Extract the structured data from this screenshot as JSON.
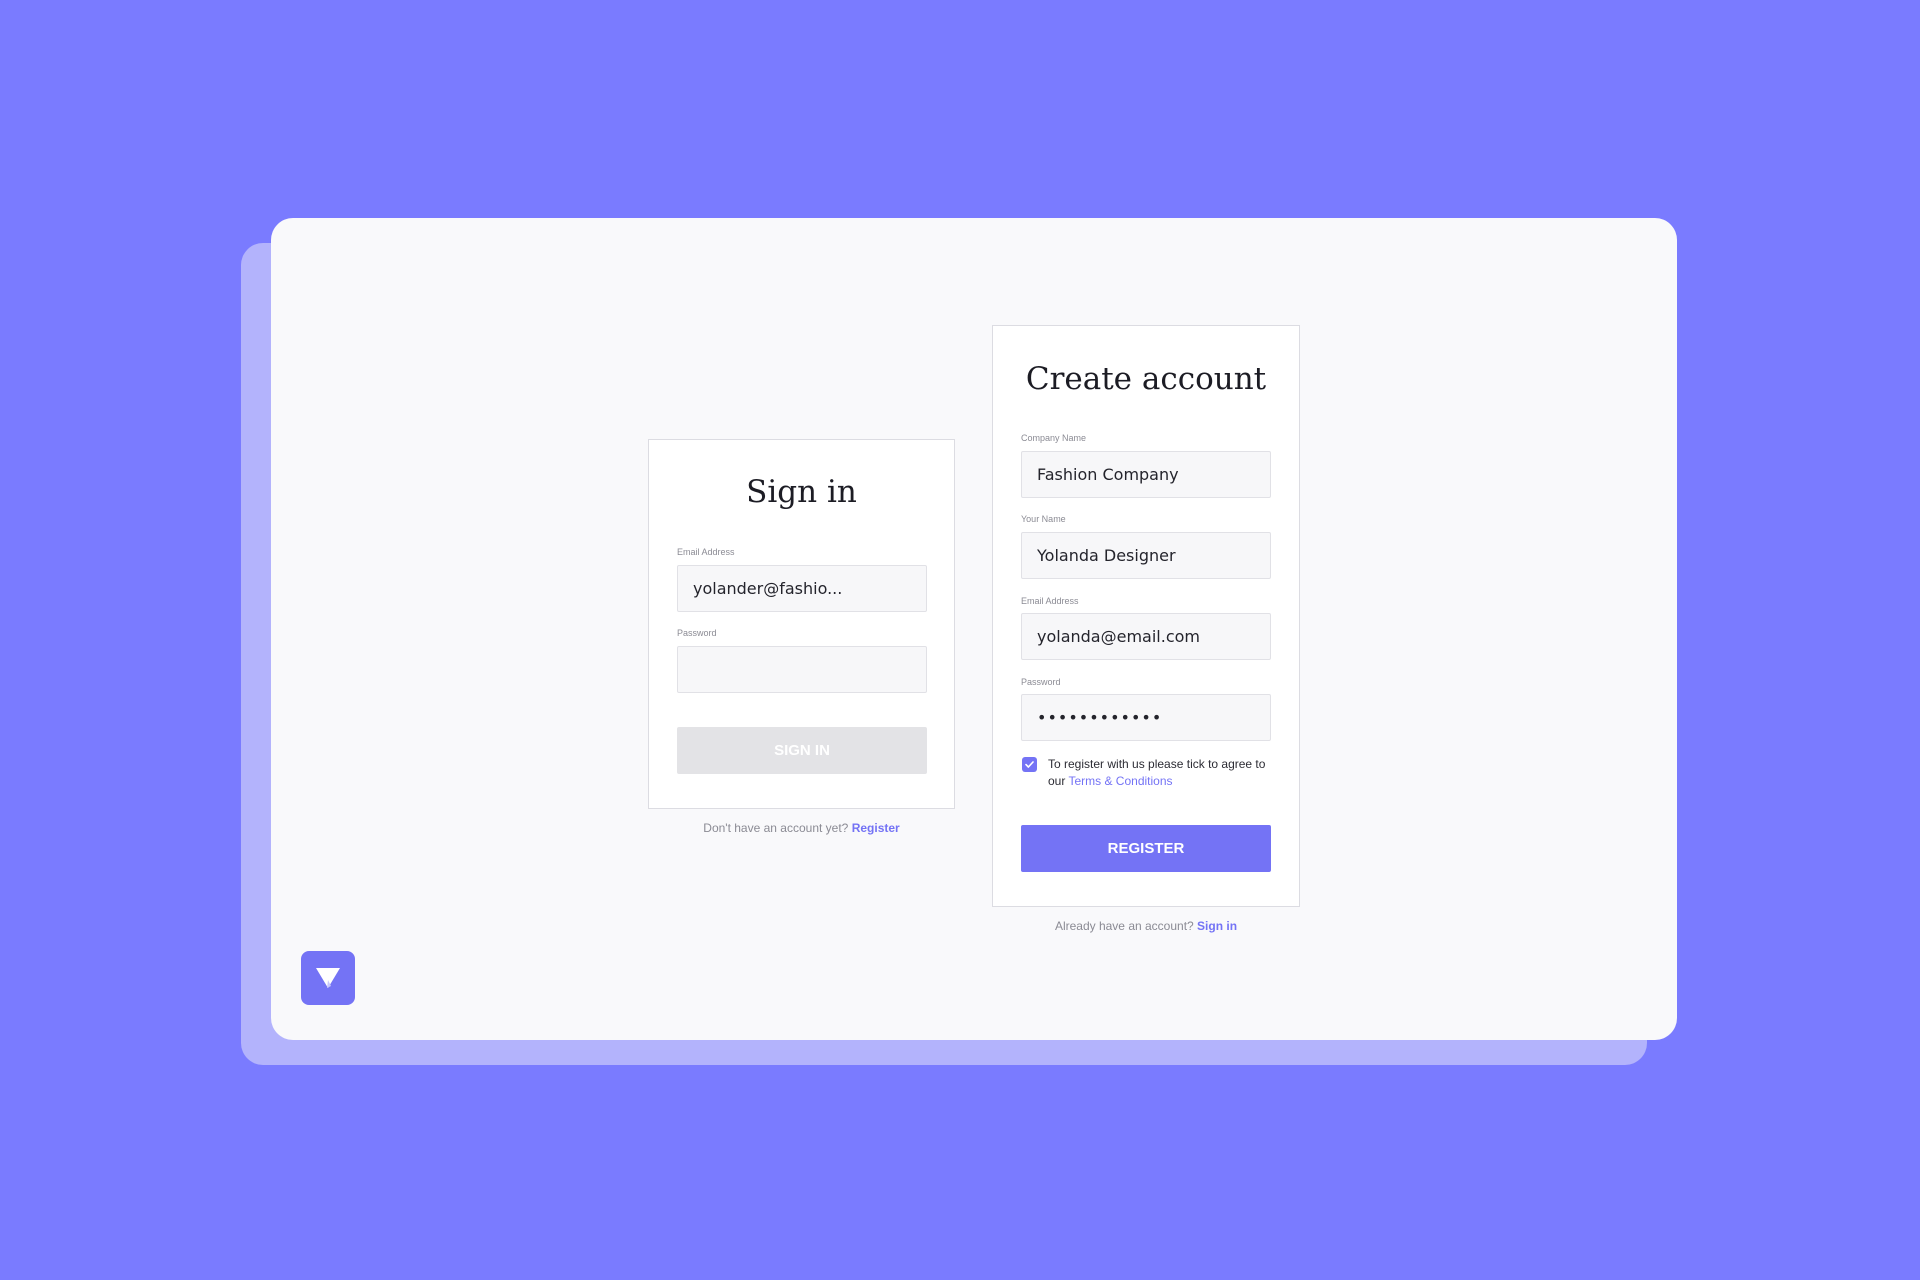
{
  "signin": {
    "title": "Sign in",
    "email_label": "Email Address",
    "email_value": "yolander@fashio...",
    "password_label": "Password",
    "password_value": "",
    "button_label": "SIGN IN",
    "footer_text": "Don't have an account yet?",
    "footer_link": "Register"
  },
  "register": {
    "title": "Create account",
    "company_label": "Company Name",
    "company_value": "Fashion Company",
    "name_label": "Your Name",
    "name_value": "Yolanda Designer",
    "email_label": "Email Address",
    "email_value": "yolanda@email.com",
    "password_label": "Password",
    "password_value": "••••••••••••",
    "terms_text": "To register with us please tick to agree to our",
    "terms_link": "Terms & Conditions",
    "terms_checked": true,
    "button_label": "REGISTER",
    "footer_text": "Already have an account?",
    "footer_link": "Sign in"
  },
  "logo": {
    "icon": "triangle-logo-icon"
  },
  "colors": {
    "background": "#7a7bff",
    "accent": "#7473f5",
    "panel": "#f9f9fb",
    "disabled_button": "#e3e3e6"
  }
}
